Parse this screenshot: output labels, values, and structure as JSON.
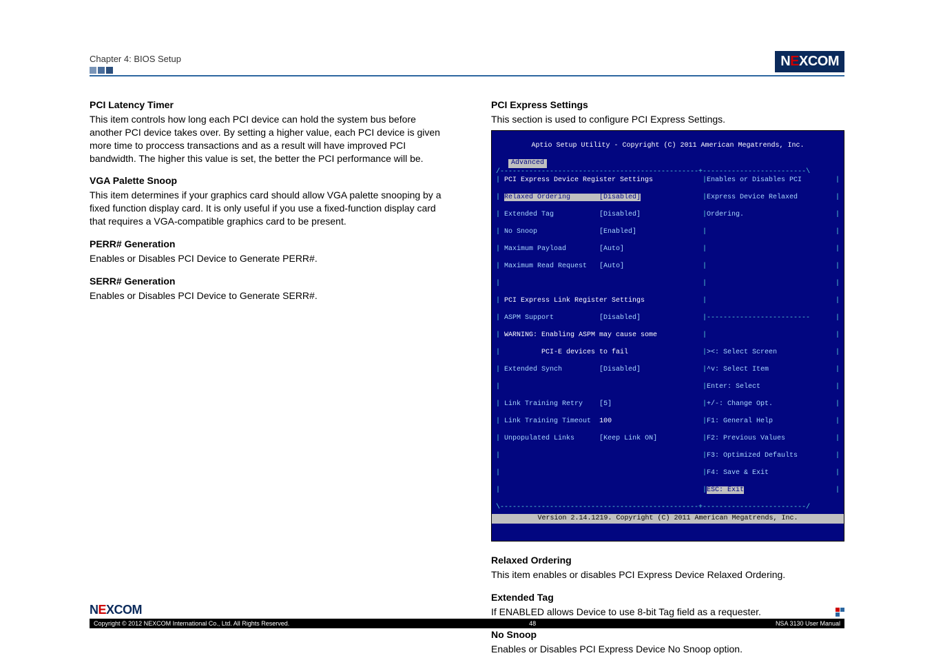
{
  "brand": "NEXCOM",
  "chapter": "Chapter 4: BIOS Setup",
  "left": {
    "s1_title": "PCI Latency Timer",
    "s1_body": "This item controls how long each PCI device can hold the system bus before another PCI device takes over. By setting a higher value, each PCI device is given more time to proccess transactions and as a result will have improved PCI bandwidth. The higher this value is set, the better the PCI performance will be.",
    "s2_title": "VGA Palette Snoop",
    "s2_body": "This item determines if your graphics card should allow VGA palette snooping by a fixed function display card. It is only useful if you use a fixed-function display card that requires a VGA-compatible graphics card to be present.",
    "s3_title": "PERR# Generation",
    "s3_body": "Enables or Disables PCI Device to Generate PERR#.",
    "s4_title": "SERR# Generation",
    "s4_body": "Enables or Disables PCI Device to Generate SERR#."
  },
  "right": {
    "h1": "PCI Express Settings",
    "h1_body": "This section is used to configure PCI Express Settings.",
    "s1_title": "Relaxed Ordering",
    "s1_body": "This item enables or disables PCI Express Device Relaxed Ordering.",
    "s2_title": "Extended Tag",
    "s2_body": "If ENABLED allows Device to use 8-bit Tag field as a requester.",
    "s3_title": "No Snoop",
    "s3_body": "Enables or Disables PCI Express Device No Snoop option."
  },
  "bios": {
    "title": "Aptio Setup Utility - Copyright (C) 2011 American Megatrends, Inc.",
    "tab": "Advanced",
    "grp1": "PCI Express Device Register Settings",
    "row_relaxed_l": "Relaxed Ordering",
    "row_relaxed_v": "[Disabled]",
    "row_exttag_l": "Extended Tag",
    "row_exttag_v": "[Disabled]",
    "row_nosnoop_l": "No Snoop",
    "row_nosnoop_v": "[Enabled]",
    "row_maxpay_l": "Maximum Payload",
    "row_maxpay_v": "[Auto]",
    "row_maxread_l": "Maximum Read Request",
    "row_maxread_v": "[Auto]",
    "grp2": "PCI Express Link Register Settings",
    "row_aspm_l": "ASPM Support",
    "row_aspm_v": "[Disabled]",
    "warn1": "WARNING: Enabling ASPM may cause some",
    "warn2": "         PCI-E devices to fail",
    "row_esync_l": "Extended Synch",
    "row_esync_v": "[Disabled]",
    "row_retry_l": "Link Training Retry",
    "row_retry_v": "[5]",
    "row_timeout_l": "Link Training Timeout",
    "row_timeout_v": "100",
    "row_unpop_l": "Unpopulated Links",
    "row_unpop_v": "[Keep Link ON]",
    "help1": "Enables or Disables PCI",
    "help2": "Express Device Relaxed",
    "help3": "Ordering.",
    "nav1": "><: Select Screen",
    "nav2": "^v: Select Item",
    "nav3": "Enter: Select",
    "nav4": "+/-: Change Opt.",
    "nav5": "F1: General Help",
    "nav6": "F2: Previous Values",
    "nav7": "F3: Optimized Defaults",
    "nav8": "F4: Save & Exit",
    "nav9": "ESC: Exit",
    "footer": "Version 2.14.1219. Copyright (C) 2011 American Megatrends, Inc."
  },
  "footer": {
    "copyright": "Copyright © 2012 NEXCOM International Co., Ltd. All Rights Reserved.",
    "page": "48",
    "manual": "NSA 3130 User Manual"
  }
}
